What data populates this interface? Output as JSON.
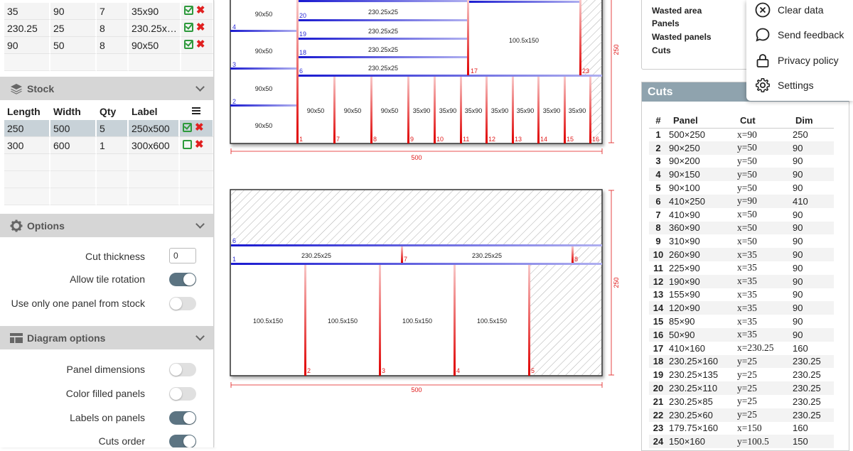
{
  "panels": {
    "rows": [
      {
        "length": "35",
        "width": "90",
        "qty": "7",
        "label": "35x90"
      },
      {
        "length": "230.25",
        "width": "25",
        "qty": "8",
        "label": "230.25x…"
      },
      {
        "length": "90",
        "width": "50",
        "qty": "8",
        "label": "90x50"
      }
    ]
  },
  "stock": {
    "title": "Stock",
    "headers": {
      "length": "Length",
      "width": "Width",
      "qty": "Qty",
      "label": "Label"
    },
    "rows": [
      {
        "length": "250",
        "width": "500",
        "qty": "5",
        "label": "250x500"
      },
      {
        "length": "300",
        "width": "600",
        "qty": "1",
        "label": "300x600"
      }
    ]
  },
  "options": {
    "title": "Options",
    "cut_thickness_label": "Cut thickness",
    "cut_thickness_value": "0",
    "allow_rotation_label": "Allow tile rotation",
    "one_panel_label": "Use only one panel from stock"
  },
  "diagram_options": {
    "title": "Diagram options",
    "panel_dimensions_label": "Panel dimensions",
    "color_filled_label": "Color filled panels",
    "labels_on_panels_label": "Labels on panels",
    "cuts_order_label": "Cuts order"
  },
  "toggles": {
    "allow_rotation": true,
    "one_panel": false,
    "panel_dimensions": false,
    "color_filled": false,
    "labels_on_panels": true,
    "cuts_order": true
  },
  "colors": {
    "accent": "#5c7482",
    "cut_blue": "#2a2ad6",
    "cut_red": "#e01818",
    "header": "#8fa3ae"
  },
  "diagram1": {
    "width_label": "500",
    "height_label": "250",
    "left_labels": [
      "90x50",
      "90x50",
      "90x50",
      "90x50"
    ],
    "strip_labels": [
      "230.25x25",
      "230.25x25",
      "230.25x25",
      "230.25x25"
    ],
    "big_label": "100.5x150",
    "bottom_labels": [
      "90x50",
      "90x50",
      "90x50",
      "35x90",
      "35x90",
      "35x90",
      "35x90",
      "35x90",
      "35x90",
      "35x90"
    ],
    "cut_numbers": [
      "4",
      "3",
      "2",
      "1",
      "20",
      "19",
      "18",
      "6",
      "17",
      "23",
      "7",
      "8",
      "9",
      "10",
      "11",
      "12",
      "13",
      "14",
      "15",
      "16"
    ]
  },
  "diagram2": {
    "width_label": "500",
    "height_label": "250",
    "strip_labels": [
      "230.25x25",
      "230.25x25"
    ],
    "big_labels": [
      "100.5x150",
      "100.5x150",
      "100.5x150",
      "100.5x150"
    ],
    "cut_numbers": [
      "6",
      "1",
      "7",
      "8",
      "2",
      "3",
      "4",
      "5"
    ]
  },
  "stats": {
    "wasted_area": "Wasted area",
    "panels": "Panels",
    "wasted_panels": "Wasted panels",
    "cuts": "Cuts"
  },
  "menu": {
    "clear": "Clear data",
    "feedback": "Send feedback",
    "privacy": "Privacy policy",
    "settings": "Settings"
  },
  "cuts_table": {
    "title": "Cuts",
    "headers": {
      "n": "#",
      "panel": "Panel",
      "cut": "Cut",
      "dim": "Dim"
    },
    "rows": [
      [
        "1",
        "500×250",
        "x=90",
        "250"
      ],
      [
        "2",
        "90×250",
        "y=50",
        "90"
      ],
      [
        "3",
        "90×200",
        "y=50",
        "90"
      ],
      [
        "4",
        "90×150",
        "y=50",
        "90"
      ],
      [
        "5",
        "90×100",
        "y=50",
        "90"
      ],
      [
        "6",
        "410×250",
        "y=90",
        "410"
      ],
      [
        "7",
        "410×90",
        "x=50",
        "90"
      ],
      [
        "8",
        "360×90",
        "x=50",
        "90"
      ],
      [
        "9",
        "310×90",
        "x=50",
        "90"
      ],
      [
        "10",
        "260×90",
        "x=35",
        "90"
      ],
      [
        "11",
        "225×90",
        "x=35",
        "90"
      ],
      [
        "12",
        "190×90",
        "x=35",
        "90"
      ],
      [
        "13",
        "155×90",
        "x=35",
        "90"
      ],
      [
        "14",
        "120×90",
        "x=35",
        "90"
      ],
      [
        "15",
        "85×90",
        "x=35",
        "90"
      ],
      [
        "16",
        "50×90",
        "x=35",
        "90"
      ],
      [
        "17",
        "410×160",
        "x=230.25",
        "160"
      ],
      [
        "18",
        "230.25×160",
        "y=25",
        "230.25"
      ],
      [
        "19",
        "230.25×135",
        "y=25",
        "230.25"
      ],
      [
        "20",
        "230.25×110",
        "y=25",
        "230.25"
      ],
      [
        "21",
        "230.25×85",
        "y=25",
        "230.25"
      ],
      [
        "22",
        "230.25×60",
        "y=25",
        "230.25"
      ],
      [
        "23",
        "179.75×160",
        "x=150",
        "160"
      ],
      [
        "24",
        "150×160",
        "y=100.5",
        "150"
      ]
    ]
  }
}
